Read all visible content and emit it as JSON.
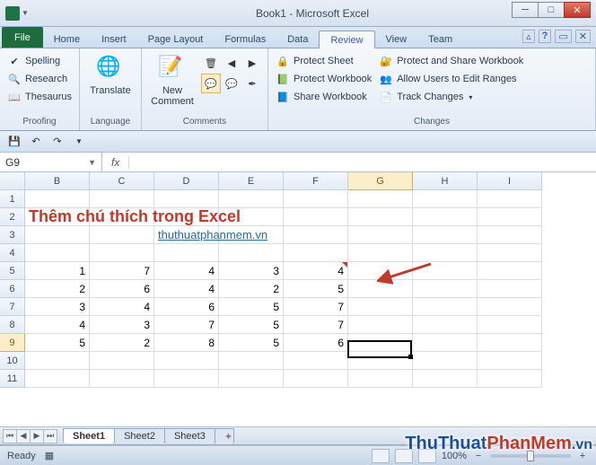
{
  "window": {
    "title": "Book1 - Microsoft Excel"
  },
  "tabs": {
    "file": "File",
    "list": [
      "Home",
      "Insert",
      "Page Layout",
      "Formulas",
      "Data",
      "Review",
      "View",
      "Team"
    ],
    "active": "Review"
  },
  "ribbon": {
    "proofing": {
      "label": "Proofing",
      "spelling": "Spelling",
      "research": "Research",
      "thesaurus": "Thesaurus"
    },
    "language": {
      "label": "Language",
      "translate": "Translate"
    },
    "comments": {
      "label": "Comments",
      "new_comment": "New\nComment"
    },
    "changes": {
      "label": "Changes",
      "protect_sheet": "Protect Sheet",
      "protect_workbook": "Protect Workbook",
      "share_workbook": "Share Workbook",
      "protect_share": "Protect and Share Workbook",
      "allow_users": "Allow Users to Edit Ranges",
      "track_changes": "Track Changes"
    }
  },
  "namebox": "G9",
  "formula": "",
  "columns": [
    "B",
    "C",
    "D",
    "E",
    "F",
    "G",
    "H",
    "I"
  ],
  "heading": "Thêm chú thích trong Excel",
  "link": "thuthuatphanmem.vn",
  "rows": [
    {
      "n": 5,
      "v": [
        1,
        7,
        4,
        3,
        4
      ]
    },
    {
      "n": 6,
      "v": [
        2,
        6,
        4,
        2,
        5
      ]
    },
    {
      "n": 7,
      "v": [
        3,
        4,
        6,
        5,
        7
      ]
    },
    {
      "n": 8,
      "v": [
        4,
        3,
        7,
        5,
        7
      ]
    },
    {
      "n": 9,
      "v": [
        5,
        2,
        8,
        5,
        6
      ]
    }
  ],
  "sheets": {
    "list": [
      "Sheet1",
      "Sheet2",
      "Sheet3"
    ],
    "active": "Sheet1"
  },
  "status": {
    "ready": "Ready",
    "zoom": "100%"
  },
  "watermark": {
    "a": "ThuThuat",
    "b": "PhanMem",
    "c": ".vn"
  }
}
